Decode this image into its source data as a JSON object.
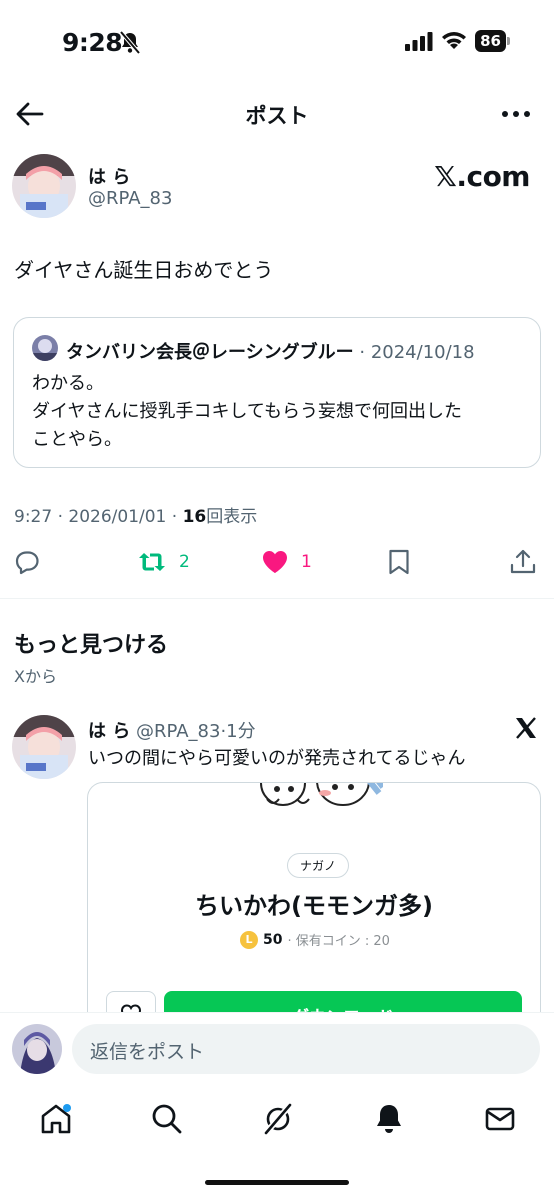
{
  "status_bar": {
    "time": "9:28",
    "battery": "86"
  },
  "header": {
    "title": "ポスト"
  },
  "post": {
    "author_name": "は ら",
    "author_handle": "@RPA_83",
    "watermark": "𝕏.com",
    "text": "ダイヤさん誕生日おめでとう",
    "quote": {
      "author_name": "タンバリン会長＠レーシングブルー",
      "date": "· 2024/10/18",
      "text_line1": "わかる。",
      "text_line2": "ダイヤさんに授乳手コキしてもらう妄想で何回出した",
      "text_line3": "ことやら。"
    },
    "meta": {
      "time": "9:27 · 2026/01/01 · ",
      "views_count": "16",
      "views_label": "回表示"
    },
    "actions": {
      "retweets": "2",
      "likes": "1"
    }
  },
  "discover": {
    "title": "もっと見つける",
    "subtitle": "Xから",
    "item": {
      "author_name": "は ら",
      "author_handle": "@RPA_83",
      "time": "·1分",
      "text": "いつの間にやら可愛いのが発売されてるじゃん",
      "card": {
        "tag": "ナガノ",
        "title": "ちいかわ(モモンガ多)",
        "coin_value": "50",
        "owned_coins": "· 保有コイン : 20",
        "button_label": "ダウンロード"
      }
    }
  },
  "reply": {
    "placeholder": "返信をポスト"
  },
  "tabbar": {
    "items": [
      "home-tab",
      "search-tab",
      "grok-tab",
      "notifications-tab",
      "messages-tab"
    ]
  },
  "colors": {
    "retweet": "#00ba7c",
    "like": "#f91880",
    "accent": "#1d9bf0",
    "download": "#06c755"
  }
}
